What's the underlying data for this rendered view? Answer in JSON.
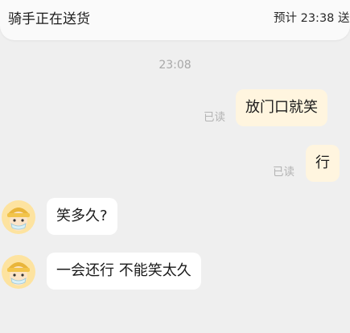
{
  "header": {
    "title": "骑手正在送货",
    "eta": "预计 23:38 送"
  },
  "chat": {
    "timestamp": "23:08",
    "messages": [
      {
        "sender": "me",
        "text": "放门口就笑",
        "status": "已读"
      },
      {
        "sender": "me",
        "text": "行",
        "status": "已读"
      },
      {
        "sender": "rider",
        "text": "笑多久?",
        "avatar": "rider-avatar-icon"
      },
      {
        "sender": "rider",
        "text": "一会还行 不能笑太久",
        "avatar": "rider-avatar-icon"
      }
    ]
  },
  "colors": {
    "background": "#efefef",
    "outgoing_bubble": "#fff5df",
    "incoming_bubble": "#ffffff",
    "muted_text": "#a8a8a8"
  }
}
